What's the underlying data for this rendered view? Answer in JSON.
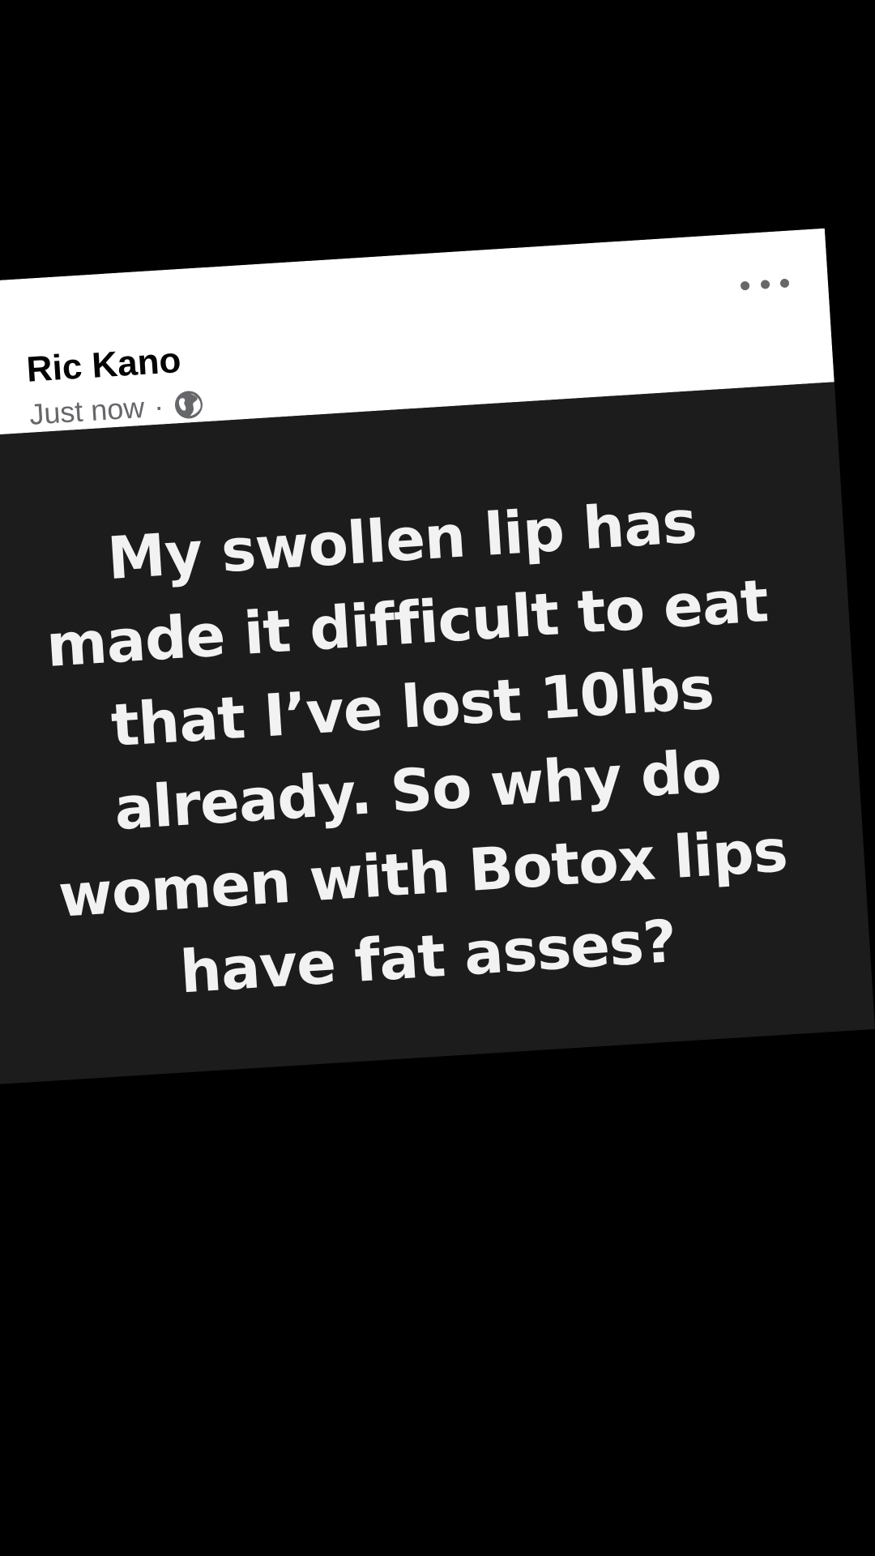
{
  "post": {
    "author": "Ric Kano",
    "timestamp": "Just now",
    "separator": "·",
    "privacy_icon": "globe-icon",
    "more_icon": "more-options-icon",
    "text_lines": [
      "My swollen lip has",
      "made it difficult to eat",
      "that I’ve lost 10lbs",
      "already. So why do",
      "women with Botox lips",
      "have fat asses?"
    ]
  },
  "colors": {
    "background": "#000000",
    "header_bg": "#ffffff",
    "body_bg": "#1c1c1c",
    "body_text": "#f2f2f2",
    "avatar_ring": "#1877f2",
    "meta_text": "#65676b"
  }
}
